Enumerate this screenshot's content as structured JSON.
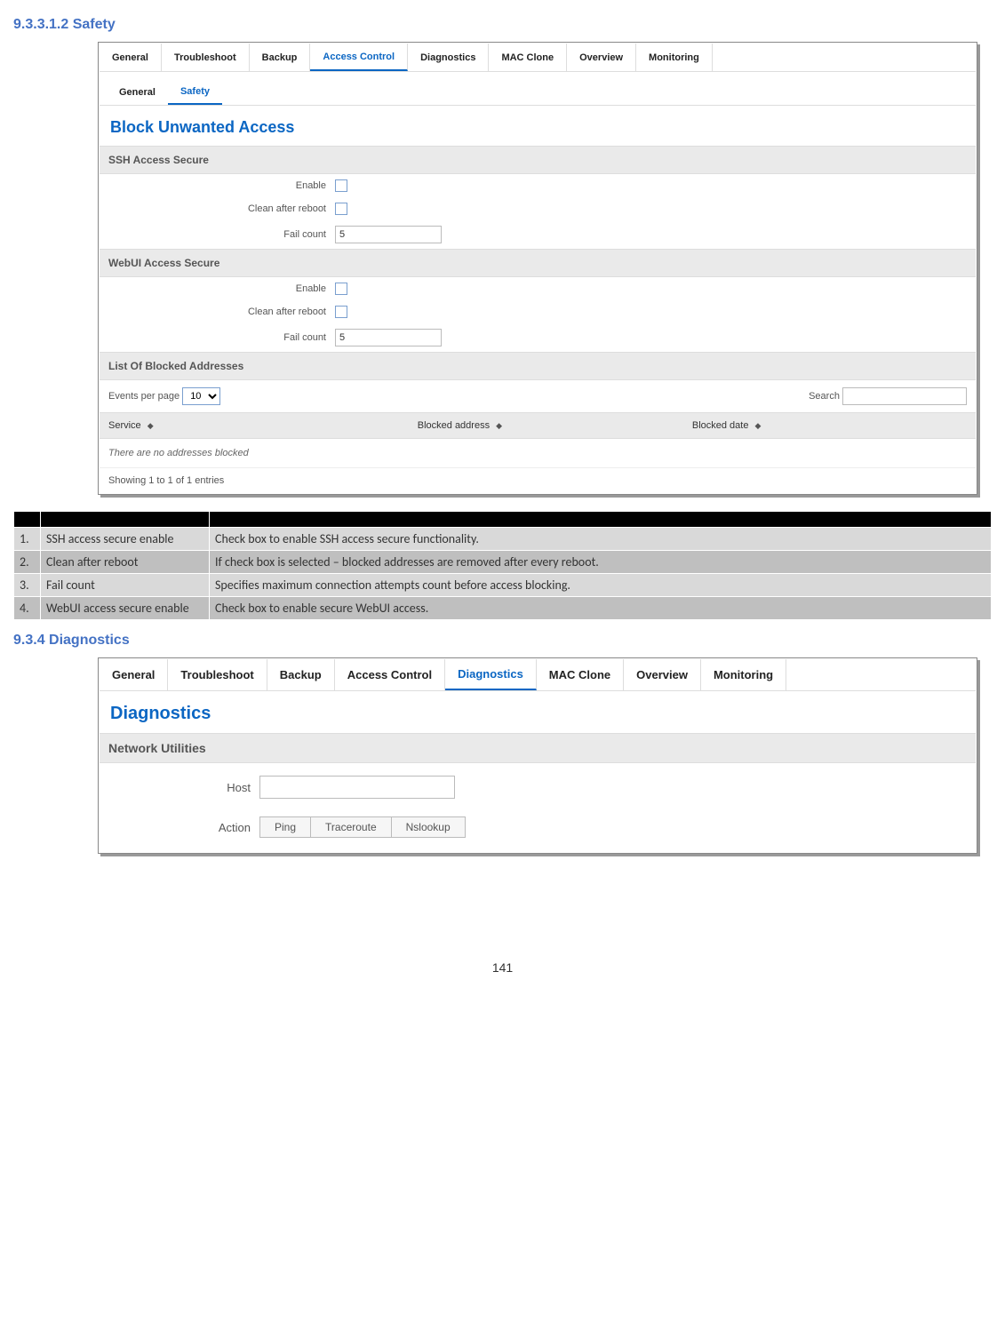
{
  "headings": {
    "safety": "9.3.3.1.2   Safety",
    "diagnostics": "9.3.4  Diagnostics"
  },
  "panel1": {
    "tabs": [
      "General",
      "Troubleshoot",
      "Backup",
      "Access Control",
      "Diagnostics",
      "MAC Clone",
      "Overview",
      "Monitoring"
    ],
    "activeTab": 3,
    "subtabs": [
      "General",
      "Safety"
    ],
    "activeSubtab": 1,
    "title": "Block Unwanted Access",
    "ssh": {
      "header": "SSH Access Secure",
      "enable_label": "Enable",
      "clean_label": "Clean after reboot",
      "fail_label": "Fail count",
      "fail_value": "5"
    },
    "webui": {
      "header": "WebUI Access Secure",
      "enable_label": "Enable",
      "clean_label": "Clean after reboot",
      "fail_label": "Fail count",
      "fail_value": "5"
    },
    "list": {
      "header": "List Of Blocked Addresses",
      "epp_label": "Events per page",
      "epp_value": "10",
      "search_label": "Search",
      "col_service": "Service",
      "col_baddr": "Blocked address",
      "col_bdate": "Blocked date",
      "empty": "There are no addresses blocked",
      "footer": "Showing 1 to 1 of 1 entries"
    }
  },
  "desc": {
    "rows": [
      {
        "n": "1.",
        "name": "SSH access  secure enable",
        "exp": "Check box to enable SSH access secure functionality."
      },
      {
        "n": "2.",
        "name": "Clean after reboot",
        "exp": "If check box is selected – blocked addresses are removed after every reboot."
      },
      {
        "n": "3.",
        "name": "Fail count",
        "exp": "Specifies maximum connection attempts count before access blocking."
      },
      {
        "n": "4.",
        "name": "WebUI access secure enable",
        "exp": "Check box to enable secure WebUI access."
      }
    ]
  },
  "panel2": {
    "tabs": [
      "General",
      "Troubleshoot",
      "Backup",
      "Access Control",
      "Diagnostics",
      "MAC Clone",
      "Overview",
      "Monitoring"
    ],
    "activeTab": 4,
    "title": "Diagnostics",
    "section": "Network Utilities",
    "host_label": "Host",
    "action_label": "Action",
    "buttons": [
      "Ping",
      "Traceroute",
      "Nslookup"
    ]
  },
  "pageNumber": "141"
}
